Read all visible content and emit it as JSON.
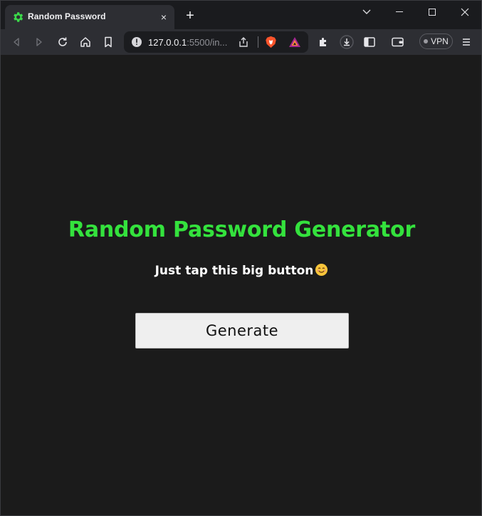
{
  "browser": {
    "tab": {
      "title": "Random Password",
      "favicon": "gear-icon",
      "close": "×"
    },
    "new_tab": "+",
    "url": {
      "host": "127.0.0.1",
      "rest": ":5500/in..."
    },
    "vpn_label": "VPN"
  },
  "page": {
    "heading": "Random Password Generator",
    "subtitle": "Just tap this big button",
    "subtitle_emoji": "smiling-face-icon",
    "button_label": "Generate"
  },
  "colors": {
    "accent_green": "#34e23d",
    "page_bg": "#1b1b1b",
    "button_bg": "#efefef"
  }
}
